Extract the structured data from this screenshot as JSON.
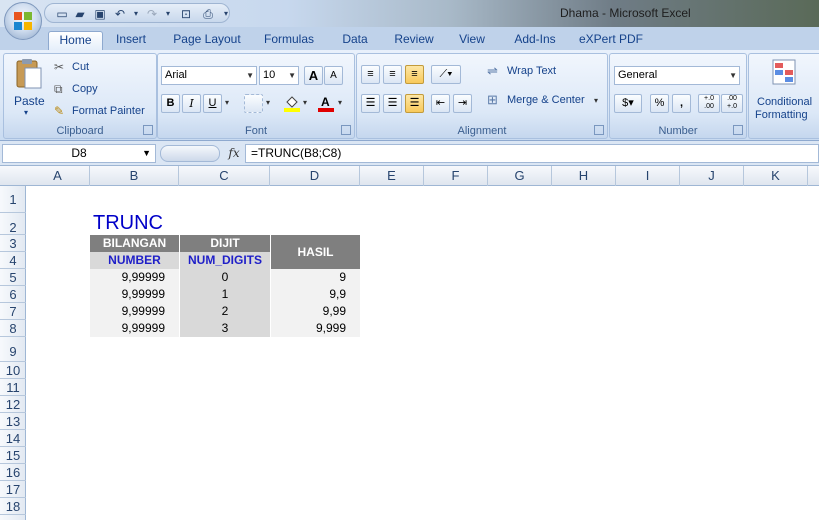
{
  "window": {
    "title": "Dhama - Microsoft Excel"
  },
  "tabs": [
    "Home",
    "Insert",
    "Page Layout",
    "Formulas",
    "Data",
    "Review",
    "View",
    "Add-Ins",
    "eXPert PDF"
  ],
  "ribbon": {
    "clipboard": {
      "label": "Clipboard",
      "paste": "Paste",
      "cut": "Cut",
      "copy": "Copy",
      "format_painter": "Format Painter"
    },
    "font": {
      "label": "Font",
      "name": "Arial",
      "size": "10",
      "bold": "B",
      "italic": "I",
      "underline": "U",
      "grow": "A",
      "shrink": "A"
    },
    "alignment": {
      "label": "Alignment",
      "wrap_text": "Wrap Text",
      "merge_center": "Merge & Center"
    },
    "number": {
      "label": "Number",
      "format": "General",
      "percent": "%",
      "comma": ",",
      "inc_decimal": "+.0 .00",
      "dec_decimal": ".00 +.0"
    },
    "styles": {
      "conditional": "Conditional",
      "formatting": "Formatting"
    }
  },
  "formula_bar": {
    "name_box": "D8",
    "fx": "fx",
    "formula": "=TRUNC(B8;C8)"
  },
  "columns": [
    "A",
    "B",
    "C",
    "D",
    "E",
    "F",
    "G",
    "H",
    "I",
    "J",
    "K"
  ],
  "rows": [
    "1",
    "2",
    "3",
    "4",
    "5",
    "6",
    "7",
    "8",
    "9",
    "10",
    "11",
    "12",
    "13",
    "14",
    "15",
    "16",
    "17",
    "18"
  ],
  "sheet": {
    "title": "TRUNC",
    "header_row1": {
      "bilangan": "BILANGAN",
      "dijit": "DIJIT",
      "hasil": "HASIL"
    },
    "header_row2": {
      "number": "NUMBER",
      "num_digits": "NUM_DIGITS"
    },
    "data": [
      {
        "number": "9,99999",
        "digits": "0",
        "result": "9"
      },
      {
        "number": "9,99999",
        "digits": "1",
        "result": "9,9"
      },
      {
        "number": "9,99999",
        "digits": "2",
        "result": "9,99"
      },
      {
        "number": "9,99999",
        "digits": "3",
        "result": "9,999"
      }
    ]
  },
  "colors": {
    "title_blue": "#0000c8",
    "header_dark": "#7f7f7f",
    "header_light": "#d9d9d9",
    "cell_light": "#f2f2f2"
  }
}
